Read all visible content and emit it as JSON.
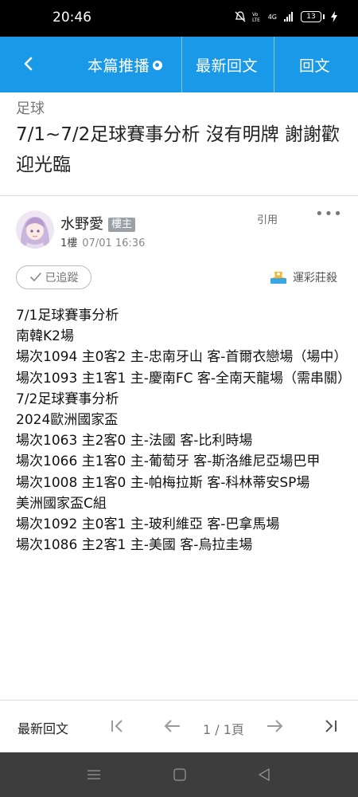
{
  "status_bar": {
    "time": "20:46",
    "network": "4G",
    "battery": "13"
  },
  "app_bar": {
    "tabs": [
      {
        "label": "本篇推播"
      },
      {
        "label": "最新回文"
      },
      {
        "label": "回文"
      }
    ]
  },
  "thread": {
    "category": "足球",
    "title": "7/1~7/2足球賽事分析 沒有明牌 謝謝歡迎光臨"
  },
  "post": {
    "author": "水野愛",
    "badge": "樓主",
    "floor": "1樓",
    "time": "07/01 16:36",
    "quote_label": "引用",
    "follow_label": "已追蹤",
    "lottery_label": "運彩莊殺",
    "lines": [
      "7/1足球賽事分析",
      "南韓K2場",
      "場次1094 主0客2 主-忠南牙山 客-首爾衣戀場（場中）",
      "場次1093 主1客1 主-慶南FC 客-全南天龍場（需串關）",
      "7/2足球賽事分析",
      "2024歐洲國家盃",
      "場次1063 主2客0 主-法國 客-比利時場",
      "場次1066 主1客0 主-葡萄牙 客-斯洛維尼亞場巴甲",
      "場次1008 主1客0 主-帕梅拉斯 客-科林蒂安SP場",
      "美洲國家盃C組",
      "場次1092 主0客1 主-玻利維亞 客-巴拿馬場",
      "場次1086 主2客1 主-美國 客-烏拉圭場"
    ]
  },
  "footer": {
    "latest_label": "最新回文",
    "page_label": "1 / 1頁"
  },
  "colors": {
    "accent": "#1a99e8",
    "navbar": "#3d3d3d"
  },
  "icons": [
    "back-arrow-icon",
    "first-page-icon",
    "prev-page-icon",
    "next-page-icon",
    "last-page-icon",
    "more-icon",
    "check-icon",
    "trophy-icon"
  ]
}
